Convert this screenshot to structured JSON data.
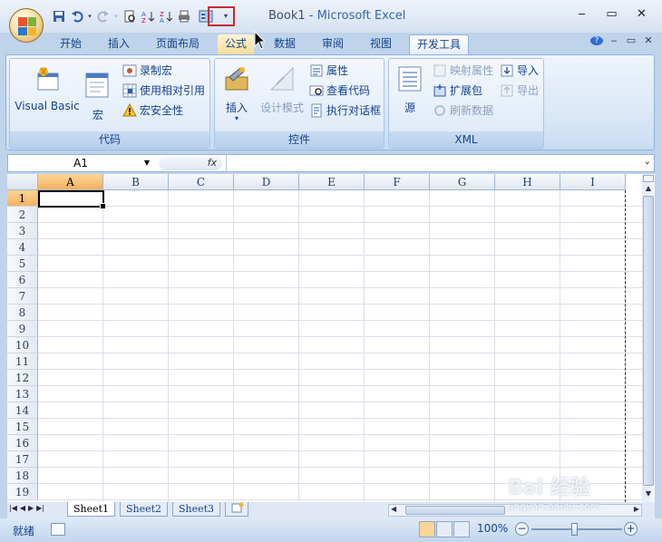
{
  "window": {
    "doc": "Book1",
    "sep": " - ",
    "app": "Microsoft Excel"
  },
  "tabs": [
    "开始",
    "插入",
    "页面布局",
    "公式",
    "数据",
    "审阅",
    "视图",
    "开发工具"
  ],
  "groups": {
    "code": {
      "label": "代码",
      "vb": "Visual Basic",
      "macros": "宏",
      "record": "录制宏",
      "relative": "使用相对引用",
      "security": "宏安全性"
    },
    "controls": {
      "label": "控件",
      "insert": "插入",
      "design": "设计模式",
      "props": "属性",
      "viewcode": "查看代码",
      "dialog": "执行对话框"
    },
    "xml": {
      "label": "XML",
      "source": "源",
      "mapprops": "映射属性",
      "expand": "扩展包",
      "refresh": "刷新数据",
      "import": "导入",
      "export": "导出"
    }
  },
  "formula": {
    "namebox": "A1",
    "fx": "fx"
  },
  "columns": [
    "A",
    "B",
    "C",
    "D",
    "E",
    "F",
    "G",
    "H",
    "I"
  ],
  "rows": [
    "1",
    "2",
    "3",
    "4",
    "5",
    "6",
    "7",
    "8",
    "9",
    "10",
    "11",
    "12",
    "13",
    "14",
    "15",
    "16",
    "17",
    "18",
    "19"
  ],
  "sheets": [
    "Sheet1",
    "Sheet2",
    "Sheet3"
  ],
  "status": {
    "ready": "就绪",
    "zoom": "100%"
  },
  "watermark": {
    "brand": "Bai 经验",
    "url": "jingyan.baidu.com"
  }
}
